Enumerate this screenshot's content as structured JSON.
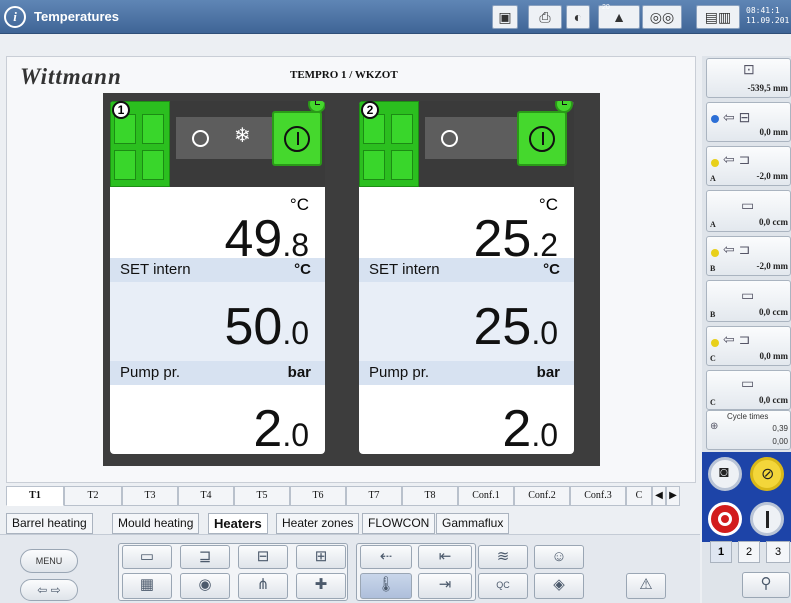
{
  "window": {
    "title": "Temperatures",
    "info_icon": "i",
    "clock_time": "08:41:1",
    "clock_date": "11.09.201",
    "badge_20": "20"
  },
  "header": {
    "brand": "Wittmann",
    "heading": "TEMPRO 1 / WKZOT"
  },
  "units": [
    {
      "number": "1",
      "actual_int": "49",
      "actual_dec": ".8",
      "actual_unit": "°C",
      "set_label": "SET intern",
      "set_unit": "°C",
      "set_int": "50",
      "set_dec": ".0",
      "pump_label": "Pump pr.",
      "pump_unit": "bar",
      "pump_int": "2",
      "pump_dec": ".0",
      "cooling_enabled": true
    },
    {
      "number": "2",
      "actual_int": "25",
      "actual_dec": ".2",
      "actual_unit": "°C",
      "set_label": "SET intern",
      "set_unit": "°C",
      "set_int": "25",
      "set_dec": ".0",
      "pump_label": "Pump pr.",
      "pump_unit": "bar",
      "pump_int": "2",
      "pump_dec": ".0",
      "cooling_enabled": false
    }
  ],
  "unit_tabs": [
    "T1",
    "T2",
    "T3",
    "T4",
    "T5",
    "T6",
    "T7",
    "T8",
    "Conf.1",
    "Conf.2",
    "Conf.3",
    "C"
  ],
  "active_unit_tab": "T1",
  "category_tabs": [
    "Barrel heating",
    "Mould heating",
    "Heaters",
    "Heater zones",
    "FLOWCON",
    "Gammaflux"
  ],
  "active_category_tab": "Heaters",
  "toolbar": {
    "menu_label": "MENU",
    "qc_label": "QC"
  },
  "sidebar": {
    "items": [
      {
        "value": "-539,5 mm",
        "letter": ""
      },
      {
        "value": "0,0 mm",
        "letter": ""
      },
      {
        "value": "-2,0 mm",
        "letter": "A"
      },
      {
        "value": "0,0 ccm",
        "letter": "A"
      },
      {
        "value": "-2,0 mm",
        "letter": "B"
      },
      {
        "value": "0,0 ccm",
        "letter": "B"
      },
      {
        "value": "0,0 mm",
        "letter": "C"
      },
      {
        "value": "0,0 ccm",
        "letter": "C"
      }
    ],
    "cycle_label": "Cycle times",
    "cycle_value1": "0,39",
    "cycle_value2": "0,00",
    "pages": [
      "1",
      "2",
      "3"
    ],
    "active_page": "1"
  },
  "colors": {
    "accent_green": "#45d82d",
    "title_blue": "#4a70a2",
    "label_band": "#d7e2f1"
  }
}
